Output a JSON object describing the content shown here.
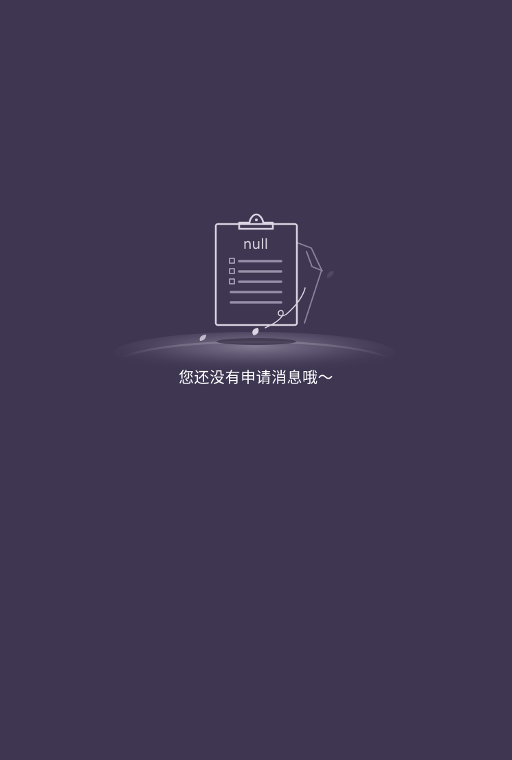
{
  "empty_state": {
    "illustration": {
      "clipboard_label": "null",
      "icon": "clipboard-icon"
    },
    "message": "您还没有申请消息哦～"
  },
  "colors": {
    "background": "#3f3752",
    "line": "#d9d5e1",
    "text": "#ffffff"
  }
}
